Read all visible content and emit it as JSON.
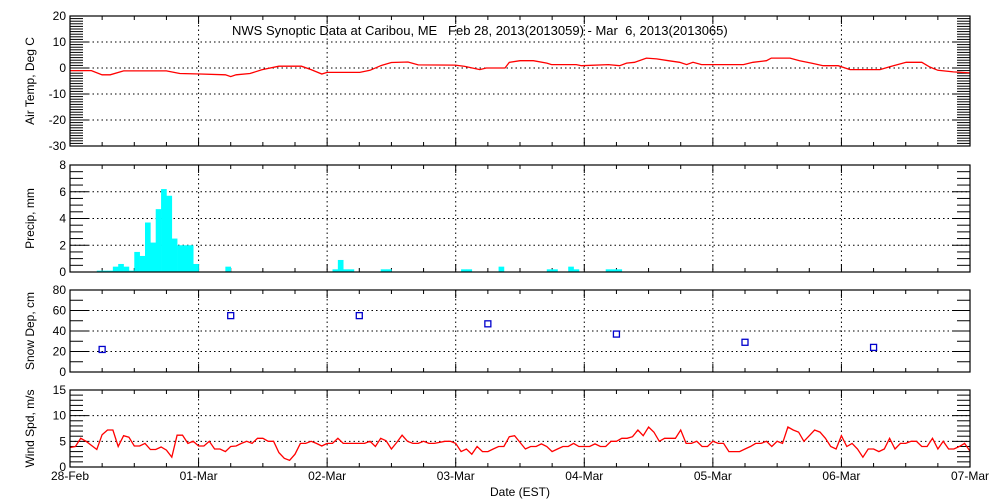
{
  "chart_data": {
    "title": "NWS Synoptic Data at Caribou, ME   Feb 28, 2013(2013059) - Mar  6, 2013(2013065)",
    "xlabel": "Date (EST)",
    "x_unit": "hours since 28-Feb 00:00",
    "x_range": [
      0,
      168
    ],
    "x_tick_labels": [
      "28-Feb",
      "01-Mar",
      "02-Mar",
      "03-Mar",
      "04-Mar",
      "05-Mar",
      "06-Mar",
      "07-Mar"
    ],
    "grid": true,
    "colors": {
      "temp": "#ff0000",
      "precip": "#00ffff",
      "snow": "#0000cc",
      "wind": "#ff0000"
    },
    "panels": [
      {
        "id": "temp",
        "type": "line",
        "ylabel": "Air Temp, Deg C",
        "ylim": [
          -30,
          20
        ],
        "ytick_step": 10,
        "minor_step": 1,
        "series": [
          [
            0,
            -1
          ],
          [
            4,
            -1
          ],
          [
            6,
            -2.6
          ],
          [
            7.5,
            -2.6
          ],
          [
            10,
            -1.1
          ],
          [
            18,
            -1.1
          ],
          [
            20.5,
            -2.1
          ],
          [
            24.3,
            -2.3
          ],
          [
            29,
            -2.6
          ],
          [
            30,
            -3.3
          ],
          [
            31,
            -2.6
          ],
          [
            33.6,
            -2.1
          ],
          [
            35.8,
            -0.7
          ],
          [
            39,
            0.7
          ],
          [
            43.2,
            0.7
          ],
          [
            45,
            -0.6
          ],
          [
            47,
            -2.3
          ],
          [
            48,
            -1.7
          ],
          [
            54.1,
            -1.7
          ],
          [
            56,
            -0.9
          ],
          [
            58,
            0.9
          ],
          [
            60,
            2.1
          ],
          [
            63.1,
            2.3
          ],
          [
            65,
            1.2
          ],
          [
            71.9,
            1.1
          ],
          [
            73.7,
            0.6
          ],
          [
            76.5,
            -0.6
          ],
          [
            77.7,
            0
          ],
          [
            81.2,
            0
          ],
          [
            82,
            2.2
          ],
          [
            84,
            2.8
          ],
          [
            86.5,
            2.8
          ],
          [
            89,
            1.9
          ],
          [
            89.9,
            1.3
          ],
          [
            94.5,
            1.3
          ],
          [
            95.5,
            0.9
          ],
          [
            100.5,
            1.3
          ],
          [
            102.6,
            0.9
          ],
          [
            103.9,
            1.9
          ],
          [
            105.4,
            2.2
          ],
          [
            107.6,
            3.8
          ],
          [
            109.5,
            3.5
          ],
          [
            111.7,
            2.8
          ],
          [
            113.8,
            2.2
          ],
          [
            115.1,
            1.3
          ],
          [
            116.3,
            2.2
          ],
          [
            117.9,
            1.3
          ],
          [
            125.7,
            1.3
          ],
          [
            127.5,
            2.2
          ],
          [
            130,
            2.8
          ],
          [
            130.9,
            3.8
          ],
          [
            134.4,
            3.8
          ],
          [
            136.2,
            2.8
          ],
          [
            138.4,
            1.9
          ],
          [
            140.6,
            0.9
          ],
          [
            143.4,
            0.9
          ],
          [
            145.6,
            -0.6
          ],
          [
            151.2,
            -0.6
          ],
          [
            153.7,
            0.9
          ],
          [
            156.1,
            2.2
          ],
          [
            159,
            2.2
          ],
          [
            160.5,
            0.4
          ],
          [
            162,
            -0.9
          ],
          [
            164.9,
            -1.5
          ],
          [
            168,
            -1.9
          ]
        ]
      },
      {
        "id": "precip",
        "type": "bar",
        "ylabel": "Precip, mm",
        "ylim": [
          0,
          8
        ],
        "ytick_step": 2,
        "minor_step": 0.5,
        "bar_width_hours": 1,
        "series": [
          [
            5,
            0.1
          ],
          [
            6,
            0.1
          ],
          [
            7,
            0.1
          ],
          [
            8,
            0.4
          ],
          [
            9,
            0.6
          ],
          [
            10,
            0.4
          ],
          [
            11,
            0.1
          ],
          [
            12,
            1.5
          ],
          [
            13,
            1.2
          ],
          [
            14,
            3.7
          ],
          [
            15,
            2.2
          ],
          [
            16,
            4.7
          ],
          [
            17,
            6.2
          ],
          [
            18,
            5.7
          ],
          [
            19,
            2.5
          ],
          [
            20,
            2.0
          ],
          [
            21,
            2.0
          ],
          [
            22,
            2.0
          ],
          [
            23,
            0.6
          ],
          [
            29,
            0.4
          ],
          [
            49,
            0.2
          ],
          [
            50,
            0.9
          ],
          [
            51,
            0.2
          ],
          [
            52,
            0.2
          ],
          [
            58,
            0.2
          ],
          [
            59,
            0.2
          ],
          [
            73,
            0.2
          ],
          [
            74,
            0.2
          ],
          [
            80,
            0.4
          ],
          [
            89,
            0.2
          ],
          [
            90,
            0.2
          ],
          [
            93,
            0.4
          ],
          [
            94,
            0.2
          ],
          [
            100,
            0.2
          ],
          [
            101,
            0.2
          ],
          [
            102,
            0.2
          ]
        ]
      },
      {
        "id": "snow",
        "type": "scatter",
        "ylabel": "Snow Dep, cm",
        "ylim": [
          0,
          80
        ],
        "ytick_step": 20,
        "minor_step": 10,
        "series": [
          [
            6,
            22
          ],
          [
            30,
            55
          ],
          [
            54,
            55
          ],
          [
            78,
            47
          ],
          [
            102,
            37
          ],
          [
            126,
            29
          ],
          [
            150,
            24
          ]
        ]
      },
      {
        "id": "wind",
        "type": "line",
        "ylabel": "Wind Spd, m/s",
        "ylim": [
          0,
          15
        ],
        "ytick_step": 5,
        "minor_step": 1,
        "series": [
          [
            0,
            3.8
          ],
          [
            1,
            4
          ],
          [
            2,
            5.6
          ],
          [
            3,
            5
          ],
          [
            5,
            3.4
          ],
          [
            6,
            6.3
          ],
          [
            7,
            7.2
          ],
          [
            8,
            7.2
          ],
          [
            9,
            4
          ],
          [
            10,
            6.1
          ],
          [
            11,
            5.8
          ],
          [
            12,
            4.1
          ],
          [
            13,
            4.1
          ],
          [
            14,
            4.6
          ],
          [
            15,
            3.4
          ],
          [
            16,
            3.4
          ],
          [
            17,
            3.9
          ],
          [
            18,
            3.3
          ],
          [
            19,
            1.9
          ],
          [
            20,
            6.2
          ],
          [
            21,
            6.2
          ],
          [
            22,
            4.6
          ],
          [
            23,
            5
          ],
          [
            24,
            4.1
          ],
          [
            25,
            4.1
          ],
          [
            26,
            5
          ],
          [
            27,
            3.5
          ],
          [
            28,
            3.5
          ],
          [
            29,
            3
          ],
          [
            30,
            4
          ],
          [
            31,
            4.1
          ],
          [
            32,
            4.6
          ],
          [
            33,
            5
          ],
          [
            34,
            4.6
          ],
          [
            35,
            5.6
          ],
          [
            36,
            5.6
          ],
          [
            37,
            5
          ],
          [
            38,
            5
          ],
          [
            39,
            2.8
          ],
          [
            40,
            1.7
          ],
          [
            41,
            1.3
          ],
          [
            42,
            2.5
          ],
          [
            43,
            4.6
          ],
          [
            44,
            4.6
          ],
          [
            45,
            5
          ],
          [
            46,
            4.6
          ],
          [
            47,
            4.1
          ],
          [
            48,
            4.6
          ],
          [
            49,
            4.6
          ],
          [
            50,
            5.6
          ],
          [
            51,
            4.6
          ],
          [
            52,
            4.6
          ],
          [
            54,
            4.6
          ],
          [
            55,
            4.6
          ],
          [
            56,
            5
          ],
          [
            57,
            4
          ],
          [
            58,
            5.6
          ],
          [
            59,
            5.1
          ],
          [
            60,
            3.5
          ],
          [
            61,
            4.8
          ],
          [
            62,
            6.2
          ],
          [
            63,
            5
          ],
          [
            64,
            4.6
          ],
          [
            65,
            4.6
          ],
          [
            66,
            5
          ],
          [
            67,
            4.6
          ],
          [
            68,
            4.6
          ],
          [
            70,
            5
          ],
          [
            71,
            5
          ],
          [
            72,
            4.6
          ],
          [
            73,
            3
          ],
          [
            74,
            3.5
          ],
          [
            75,
            2.5
          ],
          [
            76,
            4
          ],
          [
            77,
            3
          ],
          [
            78,
            3
          ],
          [
            79,
            3.5
          ],
          [
            80,
            4
          ],
          [
            81,
            4
          ],
          [
            82,
            5.9
          ],
          [
            83,
            6.1
          ],
          [
            84,
            4.8
          ],
          [
            85,
            3.5
          ],
          [
            86,
            4
          ],
          [
            87,
            4
          ],
          [
            88,
            4.5
          ],
          [
            89,
            4
          ],
          [
            90,
            3
          ],
          [
            91,
            3.5
          ],
          [
            92,
            4
          ],
          [
            93,
            4
          ],
          [
            94,
            4.6
          ],
          [
            95,
            4
          ],
          [
            96,
            4
          ],
          [
            97,
            4
          ],
          [
            98,
            4.5
          ],
          [
            99,
            4
          ],
          [
            100,
            4
          ],
          [
            101,
            5
          ],
          [
            102,
            5
          ],
          [
            103,
            5.6
          ],
          [
            104,
            5.6
          ],
          [
            105,
            5.9
          ],
          [
            106,
            7.2
          ],
          [
            107,
            6.1
          ],
          [
            108,
            7.8
          ],
          [
            109,
            6.8
          ],
          [
            110,
            5
          ],
          [
            111,
            5.6
          ],
          [
            112,
            5.6
          ],
          [
            113,
            5.6
          ],
          [
            114,
            7.2
          ],
          [
            115,
            4.6
          ],
          [
            116,
            4.6
          ],
          [
            117,
            5
          ],
          [
            118,
            4
          ],
          [
            119,
            4
          ],
          [
            120,
            5
          ],
          [
            121,
            4.6
          ],
          [
            122,
            4.6
          ],
          [
            123,
            3
          ],
          [
            124,
            3
          ],
          [
            125,
            3
          ],
          [
            126,
            3.5
          ],
          [
            127,
            4
          ],
          [
            128,
            4.6
          ],
          [
            129,
            4.6
          ],
          [
            130,
            5
          ],
          [
            131,
            4
          ],
          [
            132,
            5
          ],
          [
            133,
            4.6
          ],
          [
            134,
            7.8
          ],
          [
            135,
            7.2
          ],
          [
            136,
            6.8
          ],
          [
            137,
            5
          ],
          [
            138,
            6.1
          ],
          [
            139,
            7.2
          ],
          [
            140,
            6.8
          ],
          [
            141,
            5.6
          ],
          [
            142,
            4
          ],
          [
            143,
            3.5
          ],
          [
            144,
            6.1
          ],
          [
            145,
            4
          ],
          [
            146,
            4.6
          ],
          [
            147,
            3.5
          ],
          [
            148,
            1.9
          ],
          [
            149,
            3.5
          ],
          [
            150,
            3.5
          ],
          [
            151,
            3
          ],
          [
            152,
            3.5
          ],
          [
            153,
            5.6
          ],
          [
            154,
            3.5
          ],
          [
            155,
            4.6
          ],
          [
            156,
            4.6
          ],
          [
            157,
            5
          ],
          [
            158,
            5
          ],
          [
            159,
            4
          ],
          [
            160,
            4
          ],
          [
            161,
            5.6
          ],
          [
            162,
            3.5
          ],
          [
            163,
            5
          ],
          [
            164,
            3.5
          ],
          [
            165,
            3.5
          ],
          [
            166,
            4
          ],
          [
            167,
            4.6
          ],
          [
            168,
            3.1
          ]
        ]
      }
    ]
  }
}
